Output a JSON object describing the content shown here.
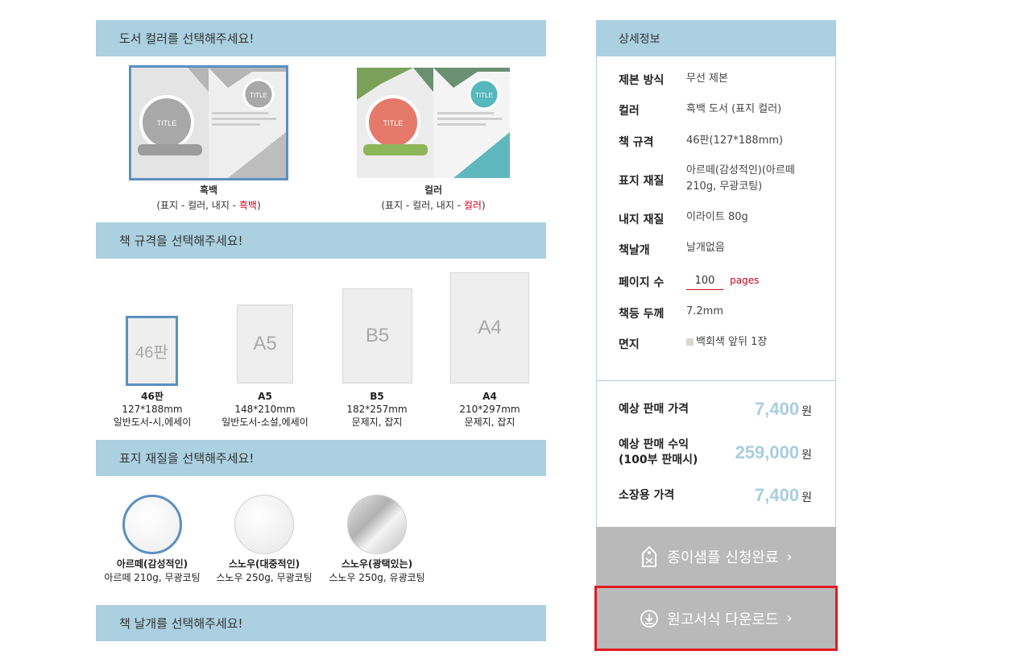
{
  "sections": {
    "color": "도서 컬러를 선택해주세요!",
    "size": "책 규격을 선택해주세요!",
    "cover": "표지 재질을 선택해주세요!",
    "flap": "책 날개를 선택해주세요!"
  },
  "color_options": [
    {
      "thumb_title": "TITLE",
      "thumb_circle": "TITLE",
      "name": "흑백",
      "sub_prefix": "(표지 - 컬러, 내지 - ",
      "sub_hl": "흑백",
      "sub_suffix": ")"
    },
    {
      "thumb_title": "TITLE",
      "thumb_circle": "TITLE",
      "name": "컬러",
      "sub_prefix": "(표지 - 컬러, 내지 - ",
      "sub_hl": "컬러",
      "sub_suffix": ")"
    }
  ],
  "size_options": [
    {
      "sheet": "46판",
      "name": "46판",
      "dims": "127*188mm",
      "use": "일반도서-시,에세이"
    },
    {
      "sheet": "A5",
      "name": "A5",
      "dims": "148*210mm",
      "use": "일반도서-소설,에세이"
    },
    {
      "sheet": "B5",
      "name": "B5",
      "dims": "182*257mm",
      "use": "문제지, 잡지"
    },
    {
      "sheet": "A4",
      "name": "A4",
      "dims": "210*297mm",
      "use": "문제지, 잡지"
    }
  ],
  "cover_options": [
    {
      "name": "아르떼(감성적인)",
      "desc": "아르떼 210g, 무광코팅"
    },
    {
      "name": "스노우(대중적인)",
      "desc": "스노우 250g, 무광코팅"
    },
    {
      "name": "스노우(광택있는)",
      "desc": "스노우 250g, 유광코팅"
    }
  ],
  "details": {
    "title": "상세정보",
    "binding_key": "제본 방식",
    "binding_val": "무선 제본",
    "color_key": "컬러",
    "color_val": "흑백 도서 (표지 컬러)",
    "size_key": "책 규격",
    "size_val": "46판(127*188mm)",
    "cover_key": "표지 재질",
    "cover_val": "아르떼(감성적인)(아르떼 210g, 무광코팅)",
    "inner_key": "내지 재질",
    "inner_val": "이라이트 80g",
    "flap_key": "책날개",
    "flap_val": "날개없음",
    "pages_key": "페이지 수",
    "pages_val": "100",
    "pages_unit": "pages",
    "spine_key": "책등 두께",
    "spine_val": "7.2mm",
    "endpaper_key": "면지",
    "endpaper_val": "백회색 앞뒤 1장"
  },
  "prices": {
    "sale_key": "예상 판매 가격",
    "sale_val": "7,400",
    "unit": "원",
    "profit_key1": "예상 판매 수익",
    "profit_key2": "(100부 판매시)",
    "profit_val": "259,000",
    "own_key": "소장용 가격",
    "own_val": "7,400"
  },
  "buttons": {
    "sample": "종이샘플 신청완료",
    "download": "원고서식 다운로드"
  },
  "colors": {
    "accent": "#abd0e0",
    "price": "#a9cde0",
    "highlight": "#e11b22",
    "button": "#b9b9b9"
  }
}
